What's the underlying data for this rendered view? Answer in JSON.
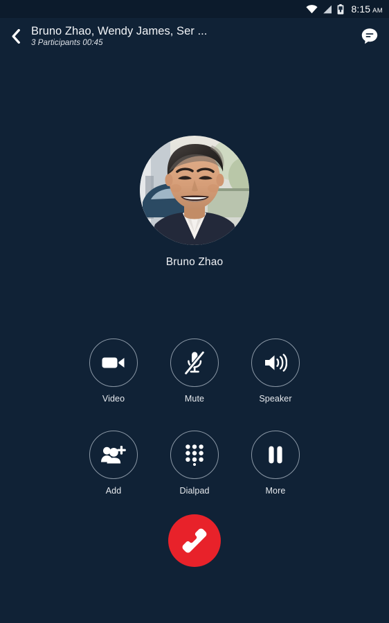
{
  "status_bar": {
    "time": "8:15",
    "am_pm": "AM",
    "icons": [
      "wifi-icon",
      "cellular-signal-icon",
      "battery-icon"
    ],
    "background_color": "#0c1b2c"
  },
  "toolbar": {
    "back_icon": "chevron-left-icon",
    "title": "Bruno Zhao, Wendy James, Ser ...",
    "subtitle": "3 Participants 00:45",
    "chat_icon": "chat-bubble-icon"
  },
  "caller": {
    "name": "Bruno Zhao",
    "avatar_alt": "Bruno Zhao"
  },
  "controls": {
    "rows": [
      [
        {
          "label": "Video",
          "icon": "video-camera-icon"
        },
        {
          "label": "Mute",
          "icon": "microphone-muted-icon"
        },
        {
          "label": "Speaker",
          "icon": "speaker-icon"
        }
      ],
      [
        {
          "label": "Add",
          "icon": "add-person-icon"
        },
        {
          "label": "Dialpad",
          "icon": "dialpad-icon"
        },
        {
          "label": "More",
          "icon": "pause-icon"
        }
      ]
    ]
  },
  "end_call": {
    "icon": "end-call-handset-icon",
    "color": "#e8222a"
  },
  "theme": {
    "background": "#102236",
    "text_primary": "#f2f4f7",
    "accent_danger": "#e8222a"
  }
}
